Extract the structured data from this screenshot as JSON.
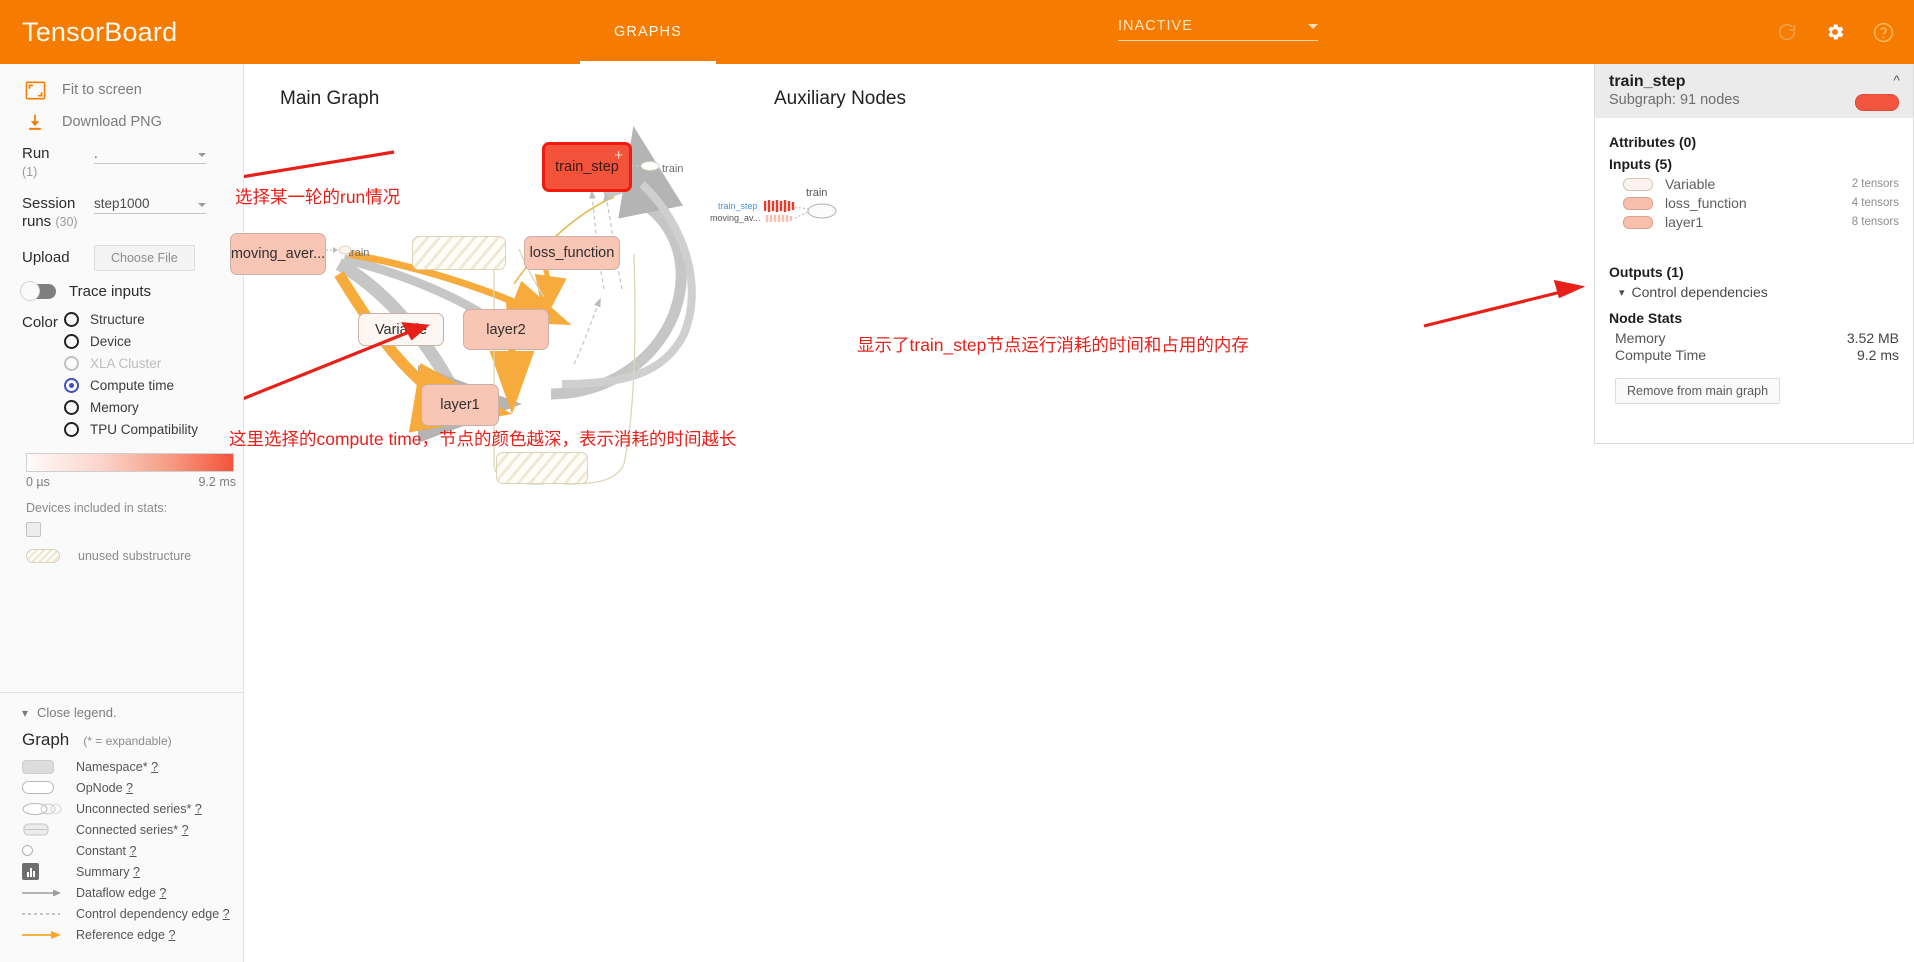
{
  "header": {
    "brand": "TensorBoard",
    "tabs": [
      {
        "label": "GRAPHS",
        "active": true
      }
    ],
    "inactive_label": "INACTIVE",
    "icons": {
      "refresh": "refresh-icon",
      "settings": "gear-icon",
      "help": "help-icon"
    }
  },
  "sidebar": {
    "fit_to_screen": "Fit to screen",
    "download_png": "Download PNG",
    "run_label": "Run",
    "run_count": "(1)",
    "run_value": ".",
    "session_label": "Session",
    "session_label2": "runs",
    "session_count": "(30)",
    "session_value": "step1000",
    "upload_label": "Upload",
    "choose_file": "Choose File",
    "trace_inputs": "Trace inputs",
    "color_label": "Color",
    "color_options": [
      {
        "label": "Structure",
        "selected": false,
        "disabled": false
      },
      {
        "label": "Device",
        "selected": false,
        "disabled": false
      },
      {
        "label": "XLA Cluster",
        "selected": false,
        "disabled": true
      },
      {
        "label": "Compute time",
        "selected": true,
        "disabled": false
      },
      {
        "label": "Memory",
        "selected": false,
        "disabled": false
      },
      {
        "label": "TPU Compatibility",
        "selected": false,
        "disabled": false
      }
    ],
    "gradient_min": "0 µs",
    "gradient_max": "9.2 ms",
    "devices_label": "Devices included in stats:",
    "unused_label": "unused substructure"
  },
  "legend": {
    "close_label": "Close legend.",
    "graph_label": "Graph",
    "expandable_note": "(* = expandable)",
    "items": [
      {
        "label": "Namespace*",
        "help": "?"
      },
      {
        "label": "OpNode",
        "help": "?"
      },
      {
        "label": "Unconnected series*",
        "help": "?"
      },
      {
        "label": "Connected series*",
        "help": "?"
      },
      {
        "label": "Constant",
        "help": "?"
      },
      {
        "label": "Summary",
        "help": "?"
      },
      {
        "label": "Dataflow edge",
        "help": "?"
      },
      {
        "label": "Control dependency edge",
        "help": "?"
      },
      {
        "label": "Reference edge",
        "help": "?"
      }
    ]
  },
  "canvas": {
    "main_graph_title": "Main Graph",
    "aux_title": "Auxiliary Nodes",
    "nodes": [
      {
        "id": "train_step",
        "label": "train_step",
        "kind": "selected",
        "expandable": "+"
      },
      {
        "id": "moving_average",
        "label": "moving_aver...",
        "kind": "namespace"
      },
      {
        "id": "loss_function",
        "label": "loss_function",
        "kind": "namespace"
      },
      {
        "id": "variable",
        "label": "Variable",
        "kind": "variable"
      },
      {
        "id": "layer2",
        "label": "layer2",
        "kind": "namespace"
      },
      {
        "id": "layer1",
        "label": "layer1",
        "kind": "namespace"
      },
      {
        "id": "unused_top",
        "label": "",
        "kind": "hatched"
      },
      {
        "id": "unused_bottom",
        "label": "",
        "kind": "hatched"
      }
    ],
    "edge_labels": [
      {
        "id": "train_edge_top",
        "label": "train"
      },
      {
        "id": "train_edge_moving",
        "label": "train"
      }
    ],
    "aux_nodes": [
      {
        "id": "aux_train_step",
        "label": "train_step"
      },
      {
        "id": "aux_moving_av",
        "label": "moving_av..."
      },
      {
        "id": "aux_train",
        "label": "train"
      }
    ],
    "annotations": [
      {
        "id": "annot-run",
        "text": "选择某一轮的run情况"
      },
      {
        "id": "annot-color",
        "text": "这里选择的compute time，节点的颜色越深，表示消耗的时间越长"
      },
      {
        "id": "annot-stats",
        "text": "显示了train_step节点运行消耗的时间和占用的内存"
      }
    ]
  },
  "info_panel": {
    "title": "train_step",
    "subtitle": "Subgraph: 91 nodes",
    "attributes_header": "Attributes (0)",
    "inputs_header": "Inputs (5)",
    "inputs": [
      {
        "name": "Variable",
        "tensors": "2 tensors",
        "color": "#fdf3ee"
      },
      {
        "name": "loss_function",
        "tensors": "4 tensors",
        "color": "#f9bfad"
      },
      {
        "name": "layer1",
        "tensors": "8 tensors",
        "color": "#f9bfad"
      }
    ],
    "outputs_header": "Outputs (1)",
    "control_dependencies": "Control dependencies",
    "node_stats_header": "Node Stats",
    "stats": [
      {
        "key": "Memory",
        "value": "3.52 MB"
      },
      {
        "key": "Compute Time",
        "value": "9.2 ms"
      }
    ],
    "remove_button": "Remove from main graph"
  },
  "colors": {
    "brand_orange": "#f57c00",
    "selected_node": "#f4533b",
    "namespace_node": "#f9c5b5",
    "accent_radio": "#3f51b5",
    "annotation_red": "#e8201a"
  }
}
